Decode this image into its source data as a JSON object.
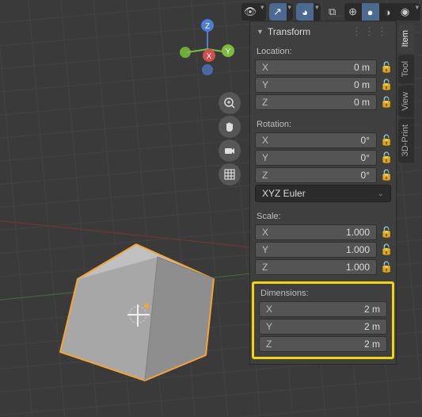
{
  "header": {
    "panel_title": "Transform"
  },
  "transform": {
    "location": {
      "title": "Location:",
      "x_label": "X",
      "x": "0 m",
      "y_label": "Y",
      "y": "0 m",
      "z_label": "Z",
      "z": "0 m"
    },
    "rotation": {
      "title": "Rotation:",
      "x_label": "X",
      "x": "0°",
      "y_label": "Y",
      "y": "0°",
      "z_label": "Z",
      "z": "0°",
      "mode": "XYZ Euler"
    },
    "scale": {
      "title": "Scale:",
      "x_label": "X",
      "x": "1.000",
      "y_label": "Y",
      "y": "1.000",
      "z_label": "Z",
      "z": "1.000"
    },
    "dimensions": {
      "title": "Dimensions:",
      "x_label": "X",
      "x": "2 m",
      "y_label": "Y",
      "y": "2 m",
      "z_label": "Z",
      "z": "2 m"
    }
  },
  "side_tabs": [
    "Item",
    "Tool",
    "View",
    "3D-Print"
  ],
  "gizmo": {
    "x": "X",
    "y": "Y",
    "z": "Z"
  }
}
